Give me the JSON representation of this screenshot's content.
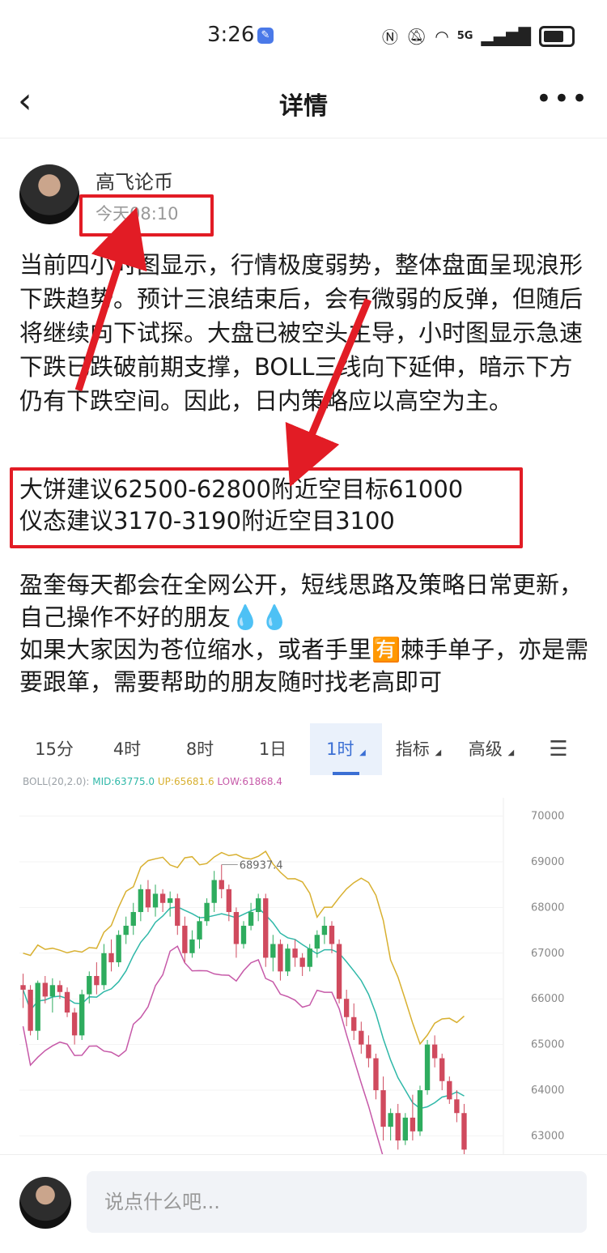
{
  "status_bar": {
    "time": "3:26",
    "network": "5G"
  },
  "header": {
    "title": "详情"
  },
  "post": {
    "author": "高飞论币",
    "time": "今天08:10",
    "body": "当前四小时图显示，行情极度弱势，整体盘面呈现浪形下跌趋势。预计三浪结束后，会有微弱的反弹，但随后将继续向下试探。大盘已被空头主导，小时图显示急速下跌已跌破前期支撑，BOLL三线向下延伸，暗示下方仍有下跌空间。因此，日内策略应以高空为主。",
    "advice_1": "大饼建议62500-62800附近空目标61000",
    "advice_2": "仪态建议3170-3190附近空目3100",
    "body2_line1": "盈奎每天都会在全网公开，短线思路及策略日常更新，自己操作不好的朋友💧💧",
    "body2_line2": "如果大家因为苍位缩水，或者手里🈶棘手单子，亦是需要跟箪，需要帮助的朋友随时找老高即可"
  },
  "chart_tabs": [
    {
      "label": "15分"
    },
    {
      "label": "4时"
    },
    {
      "label": "8时"
    },
    {
      "label": "1日"
    },
    {
      "label": "1时"
    },
    {
      "label": "指标"
    },
    {
      "label": "高级"
    }
  ],
  "boll": {
    "name": "BOLL(20,2.0):",
    "mid": "MID:63775.0",
    "up": "UP:65681.6",
    "low": "LOW:61868.4",
    "colors": {
      "name": "#9aa0a6",
      "mid": "#2fb8a8",
      "up": "#d8b030",
      "low": "#c659a8"
    }
  },
  "chart_data": {
    "type": "candlestick",
    "y_ticks": [
      "70000",
      "69000",
      "68000",
      "67000",
      "66000",
      "65000",
      "64000",
      "63000"
    ],
    "ylim": [
      62600,
      70400
    ],
    "annotations": [
      "68937.4"
    ],
    "colors": {
      "up": "#2eac5e",
      "down": "#d04a5e",
      "mid": "#2fb8a8",
      "upper": "#d8b030",
      "lower": "#c659a8"
    },
    "candles": [
      [
        66300,
        66550,
        65800,
        66200
      ],
      [
        66200,
        66300,
        65200,
        65300
      ],
      [
        65300,
        66400,
        65100,
        66350
      ],
      [
        66350,
        66500,
        65900,
        66050
      ],
      [
        66050,
        66450,
        65700,
        66300
      ],
      [
        66300,
        66400,
        66000,
        66150
      ],
      [
        66150,
        66250,
        65600,
        65700
      ],
      [
        65700,
        65800,
        65000,
        65200
      ],
      [
        65200,
        66200,
        65100,
        66100
      ],
      [
        66100,
        66600,
        65900,
        66500
      ],
      [
        66500,
        66800,
        66100,
        66300
      ],
      [
        66300,
        67200,
        66200,
        67000
      ],
      [
        67000,
        67300,
        66600,
        66800
      ],
      [
        66800,
        67500,
        66700,
        67400
      ],
      [
        67400,
        67800,
        67200,
        67600
      ],
      [
        67600,
        68100,
        67400,
        67900
      ],
      [
        67900,
        68500,
        67700,
        68400
      ],
      [
        68400,
        68600,
        67900,
        68000
      ],
      [
        68000,
        68500,
        67800,
        68300
      ],
      [
        68300,
        68400,
        67900,
        68100
      ],
      [
        68100,
        68350,
        67800,
        68200
      ],
      [
        68200,
        68300,
        67400,
        67600
      ],
      [
        67600,
        67800,
        66800,
        67000
      ],
      [
        67000,
        67500,
        66900,
        67300
      ],
      [
        67300,
        67800,
        67100,
        67700
      ],
      [
        67700,
        68200,
        67600,
        68100
      ],
      [
        68100,
        68800,
        67900,
        68600
      ],
      [
        68600,
        68937,
        68200,
        68400
      ],
      [
        68400,
        68500,
        67700,
        67900
      ],
      [
        67900,
        68000,
        66900,
        67200
      ],
      [
        67200,
        67700,
        67100,
        67600
      ],
      [
        67600,
        68100,
        67500,
        67900
      ],
      [
        67900,
        68300,
        67700,
        68200
      ],
      [
        68200,
        68300,
        66700,
        66900
      ],
      [
        66900,
        67400,
        66600,
        67200
      ],
      [
        67200,
        67300,
        66400,
        66600
      ],
      [
        66600,
        67200,
        66500,
        67100
      ],
      [
        67100,
        67300,
        66700,
        66900
      ],
      [
        66900,
        67000,
        66500,
        66700
      ],
      [
        66700,
        67200,
        66600,
        67100
      ],
      [
        67100,
        67500,
        66900,
        67400
      ],
      [
        67400,
        67800,
        67200,
        67600
      ],
      [
        67600,
        67700,
        67000,
        67200
      ],
      [
        67200,
        67300,
        65900,
        66000
      ],
      [
        66000,
        66200,
        65400,
        65600
      ],
      [
        65600,
        65900,
        65100,
        65300
      ],
      [
        65300,
        65500,
        64800,
        65000
      ],
      [
        65000,
        65200,
        64500,
        64700
      ],
      [
        64700,
        64800,
        63800,
        64000
      ],
      [
        64000,
        64300,
        62900,
        63200
      ],
      [
        63200,
        63600,
        62900,
        63500
      ],
      [
        63500,
        63700,
        62700,
        62900
      ],
      [
        62900,
        63500,
        62800,
        63400
      ],
      [
        63400,
        63900,
        62900,
        63100
      ],
      [
        63100,
        64100,
        63000,
        64000
      ],
      [
        64000,
        65100,
        63900,
        65000
      ],
      [
        65000,
        65200,
        64500,
        64700
      ],
      [
        64700,
        64800,
        64000,
        64200
      ],
      [
        64200,
        64300,
        63700,
        63800
      ],
      [
        63800,
        64000,
        63300,
        63500
      ],
      [
        63500,
        63700,
        62600,
        62700
      ]
    ]
  },
  "comment_bar": {
    "placeholder": "说点什么吧..."
  }
}
